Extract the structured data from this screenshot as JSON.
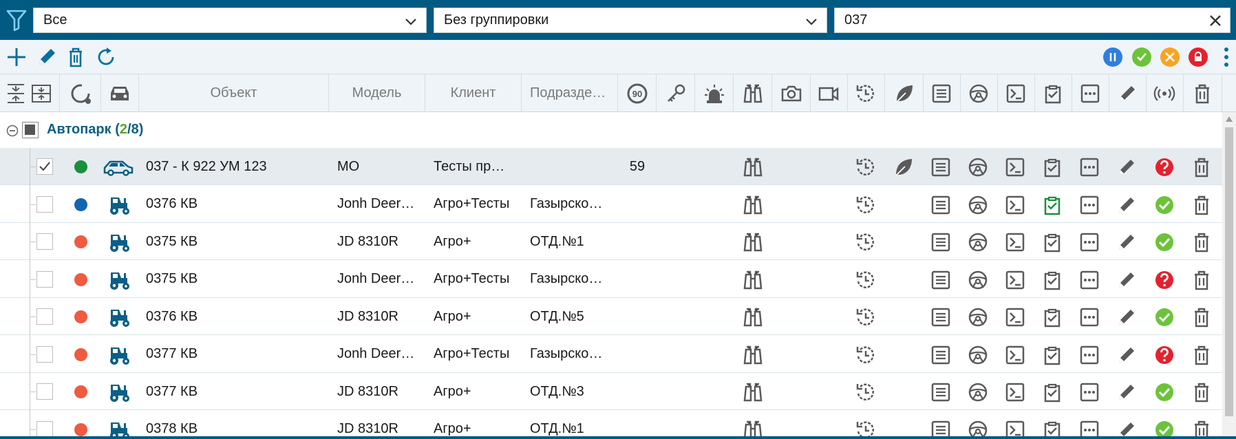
{
  "filters": {
    "status_value": "Все",
    "grouping_value": "Без группировки",
    "search_value": "037"
  },
  "status_colors": {
    "online": "#1a8f3c",
    "parked": "#1464b4",
    "offline": "#f05a40"
  },
  "toolbar": {
    "actions": [
      "plus-icon",
      "pencil-icon",
      "trash-icon",
      "refresh-icon"
    ],
    "status_buttons": [
      {
        "icon": "pause-icon",
        "color": "#2f7fe0"
      },
      {
        "icon": "check-icon",
        "color": "#6cc33a"
      },
      {
        "icon": "wrench-icon",
        "color": "#f7a424"
      },
      {
        "icon": "lock-icon",
        "color": "#e3222e"
      }
    ]
  },
  "columns": {
    "object": "Объект",
    "model": "Модель",
    "client": "Клиент",
    "division": "Подразде…",
    "speed_limit_badge": "90"
  },
  "group": {
    "name": "Автопарк",
    "selected": "2",
    "total": "8"
  },
  "rows": [
    {
      "name": "037 - К 922 УМ 123",
      "vehicle": "car",
      "status": "online",
      "model": "МО",
      "client": "Тесты пр…",
      "division": "",
      "speed": "59",
      "leaf": true,
      "checklist_green": false,
      "state": "unknown",
      "checked": true
    },
    {
      "name": "0376 КВ",
      "vehicle": "tractor",
      "status": "parked",
      "model": "Jonh Deer…",
      "client": "Агро+Тесты",
      "division": "Газырско…",
      "speed": "",
      "leaf": false,
      "checklist_green": true,
      "state": "ok",
      "checked": false
    },
    {
      "name": "0375 КВ",
      "vehicle": "tractor",
      "status": "offline",
      "model": "JD 8310R",
      "client": "Агро+",
      "division": "ОТД.№1",
      "speed": "",
      "leaf": false,
      "checklist_green": false,
      "state": "ok",
      "checked": false
    },
    {
      "name": "0375 КВ",
      "vehicle": "tractor",
      "status": "offline",
      "model": "Jonh Deer…",
      "client": "Агро+Тесты",
      "division": "Газырско…",
      "speed": "",
      "leaf": false,
      "checklist_green": false,
      "state": "unknown",
      "checked": false
    },
    {
      "name": "0376 КВ",
      "vehicle": "tractor",
      "status": "offline",
      "model": "JD 8310R",
      "client": "Агро+",
      "division": "ОТД.№5",
      "speed": "",
      "leaf": false,
      "checklist_green": false,
      "state": "ok",
      "checked": false
    },
    {
      "name": "0377 КВ",
      "vehicle": "tractor",
      "status": "offline",
      "model": "Jonh Deer…",
      "client": "Агро+Тесты",
      "division": "Газырско…",
      "speed": "",
      "leaf": false,
      "checklist_green": false,
      "state": "unknown",
      "checked": false
    },
    {
      "name": "0377 КВ",
      "vehicle": "tractor",
      "status": "offline",
      "model": "JD 8310R",
      "client": "Агро+",
      "division": "ОТД.№3",
      "speed": "",
      "leaf": false,
      "checklist_green": false,
      "state": "ok",
      "checked": false
    },
    {
      "name": "0378 КВ",
      "vehicle": "tractor",
      "status": "offline",
      "model": "JD 8310R",
      "client": "Агро+",
      "division": "ОТД.№1",
      "speed": "",
      "leaf": false,
      "checklist_green": false,
      "state": "ok",
      "checked": false
    }
  ]
}
